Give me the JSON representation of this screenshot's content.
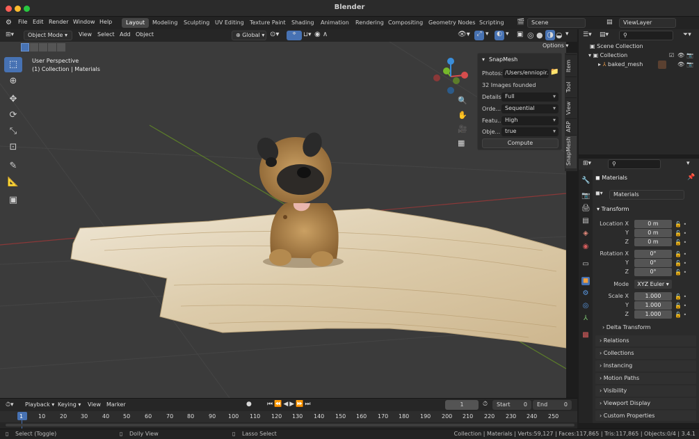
{
  "window": {
    "title": "Blender"
  },
  "menu": [
    "File",
    "Edit",
    "Render",
    "Window",
    "Help"
  ],
  "workspaces": [
    "Layout",
    "Modeling",
    "Sculpting",
    "UV Editing",
    "Texture Paint",
    "Shading",
    "Animation",
    "Rendering",
    "Compositing",
    "Geometry Nodes",
    "Scripting"
  ],
  "active_workspace": "Layout",
  "scene": {
    "scene_name": "Scene",
    "view_layer": "ViewLayer"
  },
  "viewport_header": {
    "mode": "Object Mode",
    "menus": [
      "View",
      "Select",
      "Add",
      "Object"
    ],
    "transform_orientation": "Global",
    "options_label": "Options"
  },
  "viewport_info": {
    "line1": "User Perspective",
    "line2": "(1) Collection | Materials"
  },
  "snapmesh": {
    "title": "SnapMesh",
    "photos_label": "Photos:",
    "photos_value": "/Users/enniopir...",
    "images_found": "32 Images founded",
    "rows": [
      {
        "label": "Details:",
        "value": "Full"
      },
      {
        "label": "Orde...",
        "value": "Sequential"
      },
      {
        "label": "Featu...",
        "value": "High"
      },
      {
        "label": "Obje...",
        "value": "true"
      }
    ],
    "compute_label": "Compute"
  },
  "n_tabs": [
    "Item",
    "Tool",
    "View",
    "ARP",
    "SnapMesh"
  ],
  "outliner": {
    "root": "Scene Collection",
    "collection": "Collection",
    "object": "baked_mesh"
  },
  "properties": {
    "object_name": "Materials",
    "data_name": "Materials",
    "transform_title": "Transform",
    "location": {
      "label": "Location",
      "x": "0 m",
      "y": "0 m",
      "z": "0 m"
    },
    "rotation": {
      "label": "Rotation",
      "x": "0°",
      "y": "0°",
      "z": "0°"
    },
    "mode_label": "Mode",
    "mode_value": "XYZ Euler",
    "scale": {
      "label": "Scale",
      "x": "1.000",
      "y": "1.000",
      "z": "1.000"
    },
    "axis_x": "X",
    "axis_y": "Y",
    "axis_z": "Z",
    "sections": [
      "Delta Transform",
      "Relations",
      "Collections",
      "Instancing",
      "Motion Paths",
      "Visibility",
      "Viewport Display",
      "Custom Properties"
    ]
  },
  "timeline": {
    "menus": [
      "Playback",
      "Keying",
      "View",
      "Marker"
    ],
    "current_frame": "1",
    "start_label": "Start",
    "start_value": "0",
    "end_label": "End",
    "end_value": "0",
    "ticks": [
      "1",
      "10",
      "20",
      "30",
      "40",
      "50",
      "60",
      "70",
      "80",
      "90",
      "100",
      "110",
      "120",
      "130",
      "140",
      "150",
      "160",
      "170",
      "180",
      "190",
      "200",
      "210",
      "220",
      "230",
      "240",
      "250"
    ]
  },
  "statusbar": {
    "left1": "Select (Toggle)",
    "left2": "Dolly View",
    "left3": "Lasso Select",
    "right": "Collection | Materials | Verts:59,127 | Faces:117,865 | Tris:117,865 | Objects:0/4 | 3.4.1"
  },
  "colors": {
    "accent": "#4772b3",
    "axis_x": "#d64d4d",
    "axis_y": "#76b82a",
    "axis_z": "#3a8edb",
    "active_frame": "#4772b3"
  }
}
